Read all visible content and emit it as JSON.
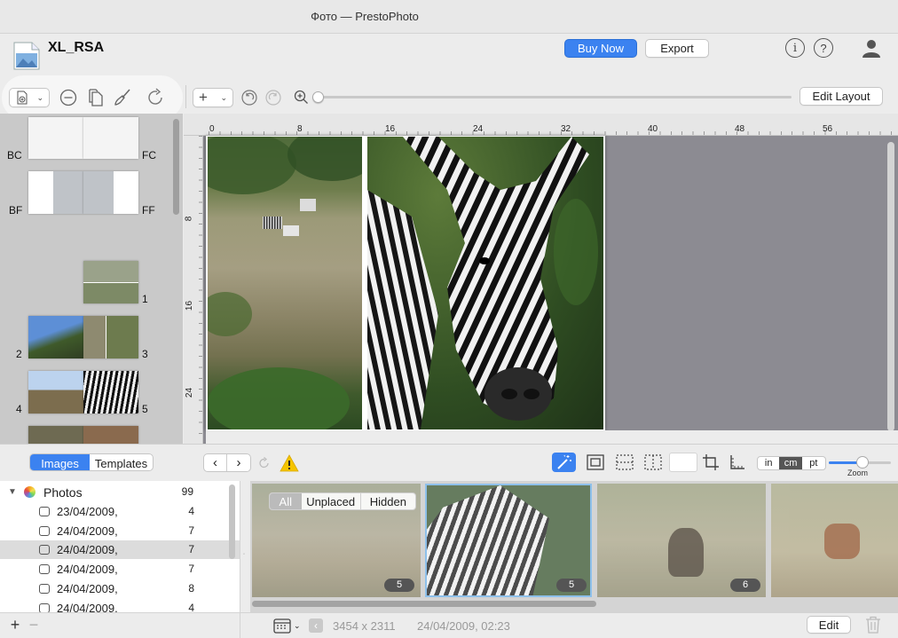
{
  "window": {
    "title": "Фото — PrestoPhoto"
  },
  "project": {
    "name": "XL_RSA"
  },
  "header": {
    "buy_now": "Buy Now",
    "export": "Export"
  },
  "toolbar": {
    "edit_layout": "Edit Layout",
    "add_label": "+"
  },
  "ruler": {
    "marks": [
      "0",
      "8",
      "16",
      "24",
      "32",
      "40",
      "48",
      "56"
    ],
    "v_marks": [
      "8",
      "16",
      "24"
    ]
  },
  "pages": {
    "bc": "BC",
    "fc": "FC",
    "bf": "BF",
    "ff": "FF",
    "p1": "1",
    "p2": "2",
    "p3": "3",
    "p4": "4",
    "p5": "5"
  },
  "tabs": {
    "images": "Images",
    "templates": "Templates"
  },
  "units": {
    "in": "in",
    "cm": "cm",
    "pt": "pt",
    "zoom": "Zoom",
    "zoom_level": 0.55
  },
  "sidebar": {
    "root": {
      "label": "Photos",
      "count": "99"
    },
    "items": [
      {
        "label": "23/04/2009,",
        "count": "4"
      },
      {
        "label": "24/04/2009,",
        "count": "7"
      },
      {
        "label": "24/04/2009,",
        "count": "7"
      },
      {
        "label": "24/04/2009,",
        "count": "7"
      },
      {
        "label": "24/04/2009,",
        "count": "8"
      },
      {
        "label": "24/04/2009,",
        "count": "4"
      }
    ]
  },
  "filter": {
    "all": "All",
    "unplaced": "Unplaced",
    "hidden": "Hidden"
  },
  "strip": {
    "counts": [
      "5",
      "5",
      "6"
    ]
  },
  "status": {
    "dimensions": "3454 x 2311",
    "date": "24/04/2009, 02:23",
    "edit": "Edit"
  },
  "colors": {
    "accent": "#2f7ae5",
    "canvas_bg": "#8c8b92",
    "warning": "#f5c400"
  }
}
